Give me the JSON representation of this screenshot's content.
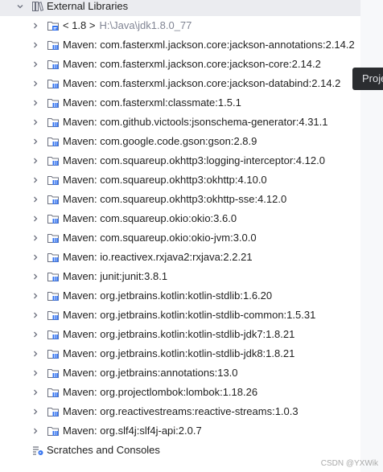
{
  "header": {
    "label": "External Libraries"
  },
  "jdk": {
    "version": "< 1.8 >",
    "path": "H:\\Java\\jdk1.8.0_77"
  },
  "libraries": [
    "Maven: com.fasterxml.jackson.core:jackson-annotations:2.14.2",
    "Maven: com.fasterxml.jackson.core:jackson-core:2.14.2",
    "Maven: com.fasterxml.jackson.core:jackson-databind:2.14.2",
    "Maven: com.fasterxml:classmate:1.5.1",
    "Maven: com.github.victools:jsonschema-generator:4.31.1",
    "Maven: com.google.code.gson:gson:2.8.9",
    "Maven: com.squareup.okhttp3:logging-interceptor:4.12.0",
    "Maven: com.squareup.okhttp3:okhttp:4.10.0",
    "Maven: com.squareup.okhttp3:okhttp-sse:4.12.0",
    "Maven: com.squareup.okio:okio:3.6.0",
    "Maven: com.squareup.okio:okio-jvm:3.0.0",
    "Maven: io.reactivex.rxjava2:rxjava:2.2.21",
    "Maven: junit:junit:3.8.1",
    "Maven: org.jetbrains.kotlin:kotlin-stdlib:1.6.20",
    "Maven: org.jetbrains.kotlin:kotlin-stdlib-common:1.5.31",
    "Maven: org.jetbrains.kotlin:kotlin-stdlib-jdk7:1.8.21",
    "Maven: org.jetbrains.kotlin:kotlin-stdlib-jdk8:1.8.21",
    "Maven: org.jetbrains:annotations:13.0",
    "Maven: org.projectlombok:lombok:1.18.26",
    "Maven: org.reactivestreams:reactive-streams:1.0.3",
    "Maven: org.slf4j:slf4j-api:2.0.7"
  ],
  "scratches": {
    "label": "Scratches and Consoles"
  },
  "tooltip": {
    "text": "Proje"
  },
  "watermark": {
    "text": "CSDN @YXWik"
  },
  "colors": {
    "header_bg": "#ebecf0",
    "jdk_path": "#818594",
    "tooltip_bg": "#2b2d30"
  },
  "icons": {
    "library": "library-icon",
    "jdk": "jdk-folder-icon",
    "scratches": "scratches-icon",
    "chevron": "chevron-right-icon"
  }
}
